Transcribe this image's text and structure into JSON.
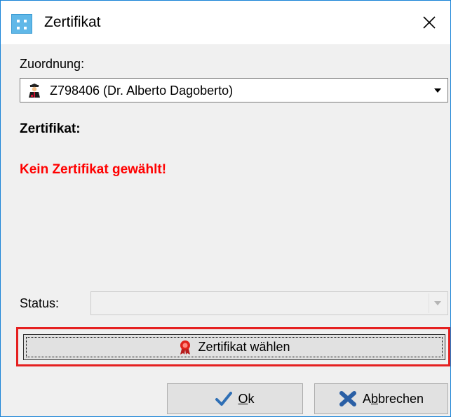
{
  "window": {
    "title": "Zertifikat",
    "close_icon": "close-icon"
  },
  "assignment": {
    "label": "Zuordnung:",
    "selected_value": "Z798406 (Dr. Alberto Dagoberto)",
    "icon": "doctor-person-icon"
  },
  "certificate": {
    "heading": "Zertifikat:",
    "message": "Kein Zertifikat gewählt!",
    "message_color": "#ff0000"
  },
  "status": {
    "label": "Status:",
    "value": ""
  },
  "choose_button": {
    "label": "Zertifikat wählen",
    "icon": "certificate-ribbon-icon",
    "highlight_color": "#e52020"
  },
  "footer": {
    "ok_label_mnemonic": "O",
    "ok_label_rest": "k",
    "ok_icon": "checkmark-icon",
    "cancel_label_first": "A",
    "cancel_label_mnemonic": "b",
    "cancel_label_rest": "brechen",
    "cancel_icon": "x-cross-icon"
  }
}
